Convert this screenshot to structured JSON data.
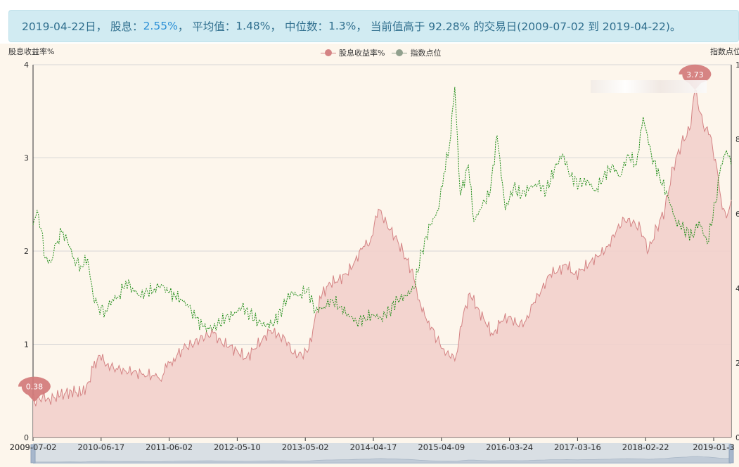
{
  "banner": {
    "date": "2019-04-22日",
    "sep1": "，",
    "dividend_label": "股息：",
    "dividend_value": "2.55%",
    "sep2": "，",
    "avg_label": "平均值：",
    "avg_value": "1.48%",
    "sep3": "，",
    "median_label": "中位数：",
    "median_value": "1.3%",
    "sep4": "，",
    "percentile_text": "当前值高于 92.28% 的交易日(2009-07-02 到 2019-04-22)。"
  },
  "colors": {
    "yield_line": "#d48384",
    "yield_fill": "#f2d0cc",
    "index_line": "#1a8a12",
    "background": "#fdf6ec",
    "marker": "#d27a79"
  },
  "chart_data": {
    "type": "area",
    "title": "",
    "y_left_title": "股息收益率%",
    "y_right_title": "指数点位",
    "y_left_ticks": [
      "0",
      "1",
      "2",
      "3",
      "4"
    ],
    "y_left_range": [
      0,
      4
    ],
    "y_right_ticks": [
      "0",
      "2",
      "4",
      "6",
      "8",
      "1"
    ],
    "y_right_range": [
      0,
      10000
    ],
    "grid": true,
    "legend_position": "top-center",
    "x_ticks": [
      "2009-07-02",
      "2010-06-17",
      "2011-06-02",
      "2012-05-10",
      "2013-05-02",
      "2014-04-17",
      "2015-04-09",
      "2016-03-24",
      "2017-03-16",
      "2018-02-22",
      "2019-01-3"
    ],
    "x_range": [
      "2009-07-02",
      "2019-04-22"
    ],
    "markers": [
      {
        "label": "0.38",
        "date": "2009-07-09",
        "value": 0.38
      },
      {
        "label": "3.73",
        "date": "2018-10-18",
        "value": 3.73
      }
    ],
    "series": [
      {
        "name": "股息收益率%",
        "axis": "left",
        "points": [
          [
            "2009-07-02",
            0.45
          ],
          [
            "2009-07-09",
            0.38
          ],
          [
            "2009-08-20",
            0.44
          ],
          [
            "2009-09-24",
            0.41
          ],
          [
            "2009-11-19",
            0.45
          ],
          [
            "2010-01-14",
            0.5
          ],
          [
            "2010-03-11",
            0.47
          ],
          [
            "2010-04-15",
            0.6
          ],
          [
            "2010-05-06",
            0.75
          ],
          [
            "2010-06-10",
            0.88
          ],
          [
            "2010-07-15",
            0.78
          ],
          [
            "2010-09-02",
            0.74
          ],
          [
            "2010-10-14",
            0.72
          ],
          [
            "2010-11-25",
            0.7
          ],
          [
            "2011-01-20",
            0.68
          ],
          [
            "2011-03-17",
            0.66
          ],
          [
            "2011-04-14",
            0.62
          ],
          [
            "2011-05-19",
            0.75
          ],
          [
            "2011-06-23",
            0.85
          ],
          [
            "2011-08-11",
            0.95
          ],
          [
            "2011-09-22",
            1.0
          ],
          [
            "2011-11-03",
            1.05
          ],
          [
            "2011-12-15",
            1.1
          ],
          [
            "2012-01-12",
            1.12
          ],
          [
            "2012-02-23",
            1.02
          ],
          [
            "2012-04-05",
            0.98
          ],
          [
            "2012-05-17",
            0.92
          ],
          [
            "2012-06-28",
            0.85
          ],
          [
            "2012-08-09",
            0.95
          ],
          [
            "2012-09-20",
            1.05
          ],
          [
            "2012-11-01",
            1.15
          ],
          [
            "2012-12-06",
            1.1
          ],
          [
            "2013-01-17",
            1.05
          ],
          [
            "2013-02-28",
            0.9
          ],
          [
            "2013-04-11",
            0.88
          ],
          [
            "2013-05-16",
            0.95
          ],
          [
            "2013-06-27",
            1.35
          ],
          [
            "2013-07-25",
            1.55
          ],
          [
            "2013-09-05",
            1.65
          ],
          [
            "2013-10-17",
            1.7
          ],
          [
            "2013-11-28",
            1.75
          ],
          [
            "2014-01-09",
            1.9
          ],
          [
            "2014-02-20",
            2.05
          ],
          [
            "2014-03-27",
            2.1
          ],
          [
            "2014-05-08",
            2.45
          ],
          [
            "2014-06-19",
            2.3
          ],
          [
            "2014-07-31",
            2.15
          ],
          [
            "2014-09-11",
            2.0
          ],
          [
            "2014-10-23",
            1.8
          ],
          [
            "2014-11-20",
            1.6
          ],
          [
            "2014-12-18",
            1.35
          ],
          [
            "2015-01-22",
            1.25
          ],
          [
            "2015-03-05",
            1.05
          ],
          [
            "2015-04-09",
            0.95
          ],
          [
            "2015-05-14",
            0.85
          ],
          [
            "2015-06-11",
            0.88
          ],
          [
            "2015-07-16",
            1.3
          ],
          [
            "2015-08-20",
            1.55
          ],
          [
            "2015-09-24",
            1.4
          ],
          [
            "2015-11-05",
            1.25
          ],
          [
            "2015-12-17",
            1.1
          ],
          [
            "2016-01-28",
            1.25
          ],
          [
            "2016-03-10",
            1.3
          ],
          [
            "2016-04-21",
            1.2
          ],
          [
            "2016-06-02",
            1.25
          ],
          [
            "2016-07-14",
            1.45
          ],
          [
            "2016-08-25",
            1.6
          ],
          [
            "2016-10-06",
            1.75
          ],
          [
            "2016-11-17",
            1.8
          ],
          [
            "2016-12-29",
            1.85
          ],
          [
            "2017-02-09",
            1.75
          ],
          [
            "2017-03-23",
            1.8
          ],
          [
            "2017-05-04",
            1.9
          ],
          [
            "2017-06-15",
            1.95
          ],
          [
            "2017-07-27",
            2.05
          ],
          [
            "2017-09-07",
            2.2
          ],
          [
            "2017-10-19",
            2.35
          ],
          [
            "2017-11-30",
            2.3
          ],
          [
            "2018-01-11",
            2.25
          ],
          [
            "2018-02-22",
            2.0
          ],
          [
            "2018-04-05",
            2.25
          ],
          [
            "2018-05-17",
            2.45
          ],
          [
            "2018-06-28",
            2.9
          ],
          [
            "2018-08-09",
            3.15
          ],
          [
            "2018-09-20",
            3.3
          ],
          [
            "2018-10-18",
            3.73
          ],
          [
            "2018-11-29",
            3.35
          ],
          [
            "2019-01-03",
            3.25
          ],
          [
            "2019-02-14",
            2.8
          ],
          [
            "2019-03-07",
            2.45
          ],
          [
            "2019-04-04",
            2.4
          ],
          [
            "2019-04-22",
            2.55
          ]
        ]
      },
      {
        "name": "指数点位",
        "axis": "right",
        "points": [
          [
            "2009-07-02",
            5700
          ],
          [
            "2009-07-23",
            6100
          ],
          [
            "2009-08-13",
            5600
          ],
          [
            "2009-09-03",
            4800
          ],
          [
            "2009-10-01",
            4700
          ],
          [
            "2009-10-29",
            5200
          ],
          [
            "2009-11-26",
            5500
          ],
          [
            "2009-12-24",
            5300
          ],
          [
            "2010-01-28",
            4800
          ],
          [
            "2010-03-04",
            4600
          ],
          [
            "2010-04-08",
            4800
          ],
          [
            "2010-05-06",
            3800
          ],
          [
            "2010-06-03",
            3500
          ],
          [
            "2010-07-08",
            3400
          ],
          [
            "2010-08-12",
            3700
          ],
          [
            "2010-09-16",
            3800
          ],
          [
            "2010-10-21",
            4200
          ],
          [
            "2010-11-25",
            4000
          ],
          [
            "2010-12-30",
            3800
          ],
          [
            "2011-02-10",
            3900
          ],
          [
            "2011-03-17",
            4000
          ],
          [
            "2011-04-21",
            4100
          ],
          [
            "2011-05-26",
            3900
          ],
          [
            "2011-06-30",
            3800
          ],
          [
            "2011-08-04",
            3700
          ],
          [
            "2011-09-08",
            3500
          ],
          [
            "2011-10-13",
            3200
          ],
          [
            "2011-11-17",
            3000
          ],
          [
            "2011-12-22",
            2900
          ],
          [
            "2012-02-02",
            3000
          ],
          [
            "2012-03-15",
            3200
          ],
          [
            "2012-04-26",
            3300
          ],
          [
            "2012-06-07",
            3500
          ],
          [
            "2012-07-19",
            3300
          ],
          [
            "2012-08-30",
            3100
          ],
          [
            "2012-10-11",
            3000
          ],
          [
            "2012-11-22",
            3100
          ],
          [
            "2013-01-03",
            3500
          ],
          [
            "2013-02-14",
            3900
          ],
          [
            "2013-03-28",
            3800
          ],
          [
            "2013-05-09",
            4000
          ],
          [
            "2013-06-20",
            3400
          ],
          [
            "2013-08-01",
            3500
          ],
          [
            "2013-09-12",
            3700
          ],
          [
            "2013-10-24",
            3500
          ],
          [
            "2013-12-05",
            3300
          ],
          [
            "2014-01-16",
            3100
          ],
          [
            "2014-02-27",
            3200
          ],
          [
            "2014-04-10",
            3300
          ],
          [
            "2014-05-22",
            3200
          ],
          [
            "2014-07-03",
            3400
          ],
          [
            "2014-08-14",
            3700
          ],
          [
            "2014-09-25",
            3800
          ],
          [
            "2014-11-06",
            4000
          ],
          [
            "2014-12-18",
            5000
          ],
          [
            "2015-01-29",
            5700
          ],
          [
            "2015-03-12",
            6100
          ],
          [
            "2015-04-09",
            7100
          ],
          [
            "2015-05-07",
            7800
          ],
          [
            "2015-06-04",
            9400
          ],
          [
            "2015-07-02",
            6500
          ],
          [
            "2015-08-13",
            7300
          ],
          [
            "2015-09-10",
            5800
          ],
          [
            "2015-10-22",
            6200
          ],
          [
            "2015-12-03",
            6600
          ],
          [
            "2016-01-07",
            8100
          ],
          [
            "2016-02-18",
            6100
          ],
          [
            "2016-03-31",
            6700
          ],
          [
            "2016-05-12",
            6500
          ],
          [
            "2016-06-23",
            6700
          ],
          [
            "2016-08-04",
            6800
          ],
          [
            "2016-09-15",
            6600
          ],
          [
            "2016-10-27",
            7200
          ],
          [
            "2016-12-08",
            7600
          ],
          [
            "2017-01-19",
            7000
          ],
          [
            "2017-03-02",
            6800
          ],
          [
            "2017-04-13",
            6900
          ],
          [
            "2017-05-25",
            6600
          ],
          [
            "2017-07-06",
            7000
          ],
          [
            "2017-08-17",
            7300
          ],
          [
            "2017-09-28",
            7000
          ],
          [
            "2017-11-09",
            7600
          ],
          [
            "2017-12-21",
            7300
          ],
          [
            "2018-01-25",
            8600
          ],
          [
            "2018-03-08",
            7600
          ],
          [
            "2018-04-19",
            7000
          ],
          [
            "2018-05-31",
            6500
          ],
          [
            "2018-07-12",
            5800
          ],
          [
            "2018-08-23",
            5600
          ],
          [
            "2018-10-04",
            5400
          ],
          [
            "2018-11-08",
            5800
          ],
          [
            "2018-12-20",
            5200
          ],
          [
            "2019-01-31",
            6300
          ],
          [
            "2019-02-28",
            7300
          ],
          [
            "2019-03-28",
            7700
          ],
          [
            "2019-04-22",
            7300
          ]
        ]
      }
    ]
  }
}
